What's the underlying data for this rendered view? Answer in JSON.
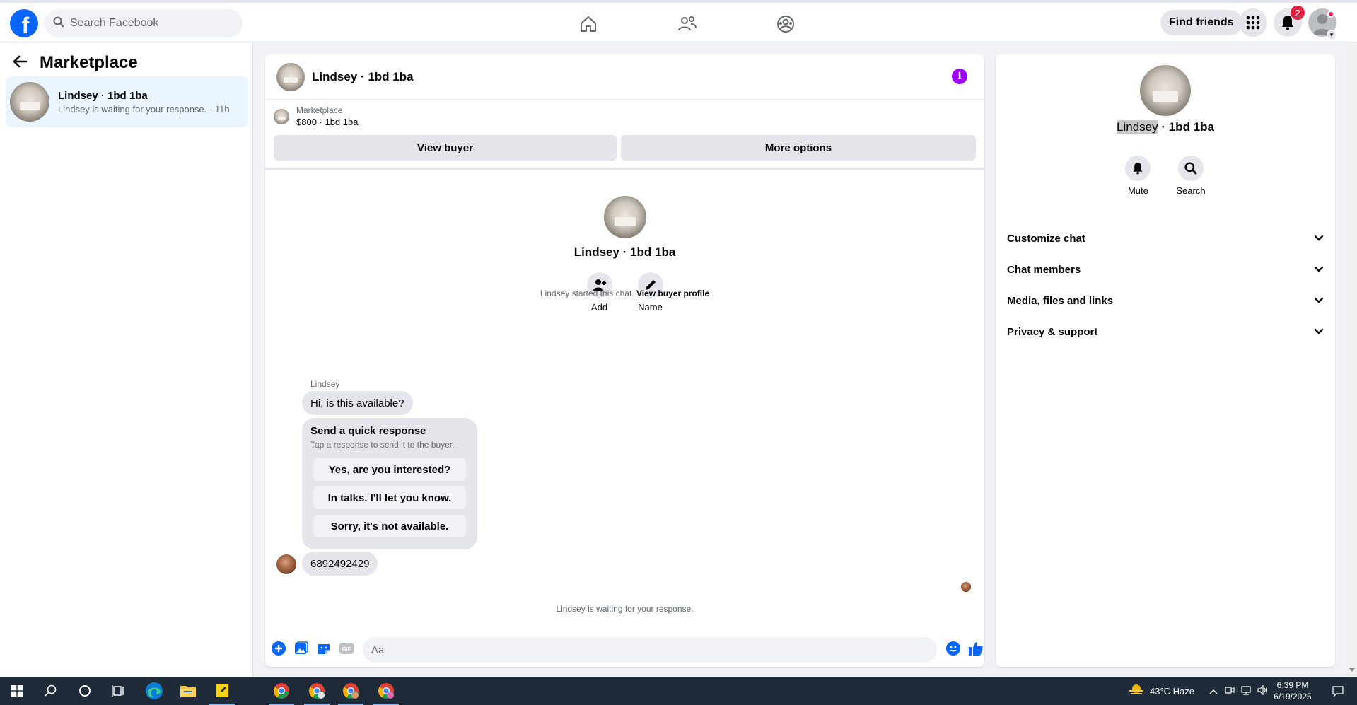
{
  "topnav": {
    "search_placeholder": "Search Facebook",
    "find_friends": "Find friends",
    "notification_count": "2",
    "brand_color": "#0866ff"
  },
  "sidebar": {
    "title": "Marketplace",
    "conversation": {
      "name": "Lindsey · 1bd 1ba",
      "preview": "Lindsey is waiting for your response. · 11h"
    }
  },
  "chat": {
    "header_name": "Lindsey · 1bd 1ba",
    "info_glyph": "i",
    "banner": {
      "label": "Marketplace",
      "listing": "$800 · 1bd 1ba",
      "view_buyer": "View buyer",
      "more_options": "More options"
    },
    "profile": {
      "name": "Lindsey · 1bd 1ba",
      "add_label": "Add",
      "name_label": "Name"
    },
    "started_text": "Lindsey started this chat.",
    "view_profile_link": "View buyer profile",
    "sender": "Lindsey",
    "first_message": "Hi, is this available?",
    "quick_response": {
      "title": "Send a quick response",
      "subtitle": "Tap a response to send it to the buyer.",
      "options": [
        "Yes, are you interested?",
        "In talks. I'll let you know.",
        "Sorry, it's not available."
      ]
    },
    "second_message": "6892492429",
    "waiting_text": "Lindsey is waiting for your response.",
    "composer_placeholder": "Aa"
  },
  "right_panel": {
    "name_highlight": "Lindsey",
    "name_rest": " · 1bd 1ba",
    "mute_label": "Mute",
    "search_label": "Search",
    "sections": [
      "Customize chat",
      "Chat members",
      "Media, files and links",
      "Privacy & support"
    ]
  },
  "taskbar": {
    "weather": "43°C  Haze",
    "time": "6:39 PM",
    "date": "6/19/2025"
  },
  "colors": {
    "accent": "#0866ff",
    "info_purple": "#a100ff",
    "badge_red": "#e41e3f"
  }
}
